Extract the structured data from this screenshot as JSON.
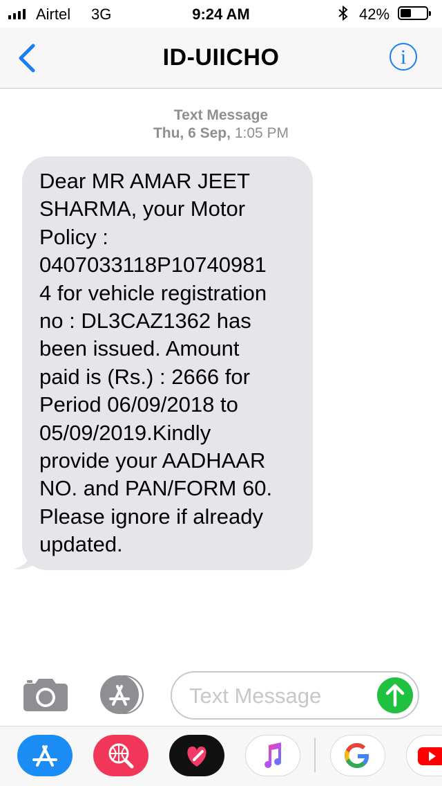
{
  "status_bar": {
    "carrier": "Airtel",
    "network": "3G",
    "time": "9:24 AM",
    "battery": "42%",
    "battery_level": 0.42
  },
  "nav": {
    "title": "ID-UIICHO",
    "back_icon": "chevron-left-icon",
    "info_icon": "info-icon",
    "info_glyph": "i"
  },
  "thread": {
    "header_type": "Text Message",
    "header_date": "Thu, 6 Sep,",
    "header_time": "1:05 PM"
  },
  "message": {
    "text": "Dear MR AMAR JEET\nSHARMA, your Motor\nPolicy :\n0407033118P10740981\n4 for vehicle registration\nno : DL3CAZ1362 has\nbeen issued. Amount\npaid is (Rs.) : 2666 for\nPeriod 06/09/2018 to\n05/09/2019.Kindly\nprovide your AADHAAR\nNO. and PAN/FORM 60.\nPlease ignore if already\nupdated."
  },
  "composer": {
    "placeholder": "Text Message",
    "camera_icon": "camera-icon",
    "apps_icon": "app-store-icon",
    "send_icon": "send-arrow-icon"
  },
  "app_drawer": {
    "apps": [
      "App Store",
      "Search Images",
      "Digital Touch",
      "Music",
      "Google",
      "YouTube"
    ]
  },
  "colors": {
    "accent": "#1a7ef2",
    "bubble": "#e5e5ea",
    "send": "#20c040",
    "secondary_text": "#8e8e93"
  }
}
